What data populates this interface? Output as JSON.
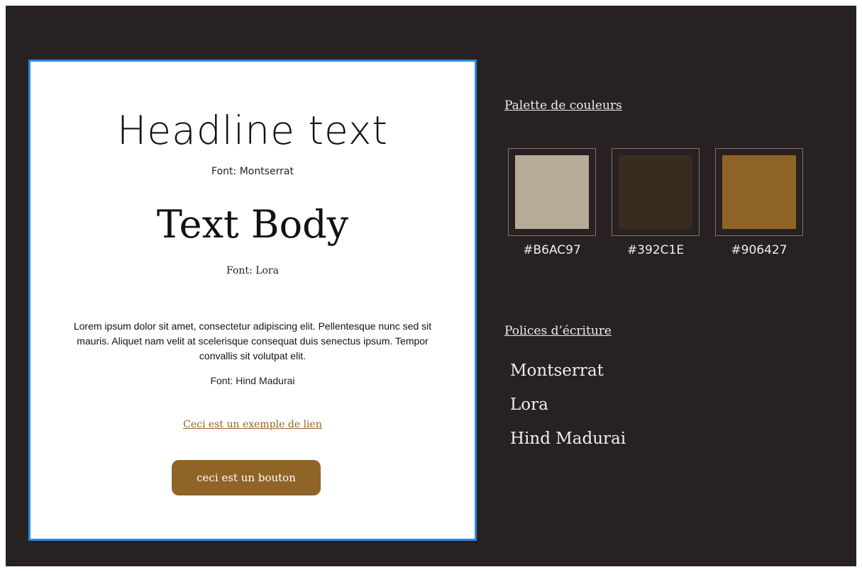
{
  "card": {
    "headline": "Headline text",
    "headline_font": "Font: Montserrat",
    "body_title": "Text Body",
    "body_font": "Font: Lora",
    "lorem": "Lorem ipsum dolor sit amet, consectetur adipiscing elit. Pellentesque nunc sed sit mauris. Aliquet nam velit at scelerisque consequat duis senectus ipsum. Tempor convallis sit volutpat elit.",
    "lorem_font": "Font: Hind Madurai",
    "link_label": "Ceci est un exemple de lien",
    "button_label": "ceci est un bouton"
  },
  "palette": {
    "title": "Palette de couleurs",
    "swatches": [
      {
        "code": "#B6AC97",
        "color": "#B6AC97"
      },
      {
        "code": "#392C1E",
        "color": "#392C1E"
      },
      {
        "code": "#906427",
        "color": "#906427"
      }
    ]
  },
  "fonts": {
    "title": "Polices d’écriture",
    "items": [
      "Montserrat",
      "Lora",
      "Hind Madurai"
    ]
  }
}
